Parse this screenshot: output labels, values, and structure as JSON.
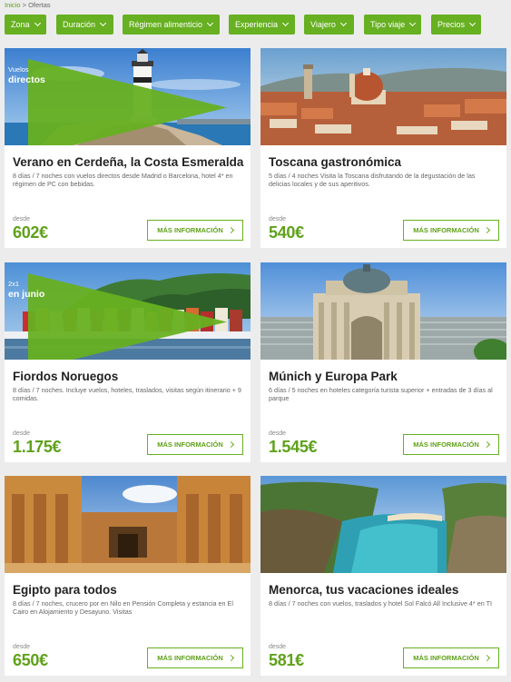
{
  "breadcrumb": {
    "home": "Inicio",
    "separator": " > ",
    "current": "Ofertas"
  },
  "filters": [
    {
      "label": "Zona"
    },
    {
      "label": "Duración"
    },
    {
      "label": "Régimen alimenticio"
    },
    {
      "label": "Experiencia"
    },
    {
      "label": "Viajero"
    },
    {
      "label": "Tipo viaje"
    },
    {
      "label": "Precios"
    }
  ],
  "colors": {
    "accent": "#67b021",
    "price": "#5fa11a",
    "background": "#ececec"
  },
  "offers": [
    {
      "title": "Verano en Cerdeña, la Costa Esmeralda",
      "description": "8 días / 7 noches con vuelos directos desde Madrid o Barcelona, hotel 4* en régimen de PC con bebidas.",
      "from_label": "desde",
      "price": "602",
      "currency": "€",
      "button": "MÁS INFORMACIÓN",
      "badge_line1": "Vuelos",
      "badge_line2": "directos",
      "image": "lighthouse-sardinia"
    },
    {
      "title": "Toscana gastronómica",
      "description": "5 días / 4 noches Visita la Toscana disfrutando de la degustación de las delicias locales y de sus aperitivos.",
      "from_label": "desde",
      "price": "540",
      "currency": "€",
      "button": "MÁS INFORMACIÓN",
      "image": "florence-skyline"
    },
    {
      "title": "Fiordos Noruegos",
      "description": "8 días / 7 noches. Incluye vuelos, hoteles, traslados, visitas según itinerario + 9 comidas.",
      "from_label": "desde",
      "price": "1.175",
      "currency": "€",
      "button": "MÁS INFORMACIÓN",
      "badge_line1": "2x1",
      "badge_line2": "en junio",
      "image": "bergen-harbour"
    },
    {
      "title": "Múnich y Europa Park",
      "description": "6 días / 5 noches en hoteles categoría turista superior + entradas de 3 días al parque",
      "from_label": "desde",
      "price": "1.545",
      "currency": "€",
      "button": "MÁS INFORMACIÓN",
      "image": "munich-palace"
    },
    {
      "title": "Egipto para todos",
      "description": "8 días / 7 noches, crucero por en Nilo en Pensión Completa y estancia en El Cairo en Alojamiento y Desayuno. Visitas",
      "from_label": "desde",
      "price": "650",
      "currency": "€",
      "button": "MÁS INFORMACIÓN",
      "image": "egypt-temple"
    },
    {
      "title": "Menorca, tus vacaciones ideales",
      "description": "8 días / 7 noches con vuelos, traslados y hotel Sol Falcó All Inclusive 4* en TI",
      "from_label": "desde",
      "price": "581",
      "currency": "€",
      "button": "MÁS INFORMACIÓN",
      "image": "menorca-cove"
    }
  ]
}
